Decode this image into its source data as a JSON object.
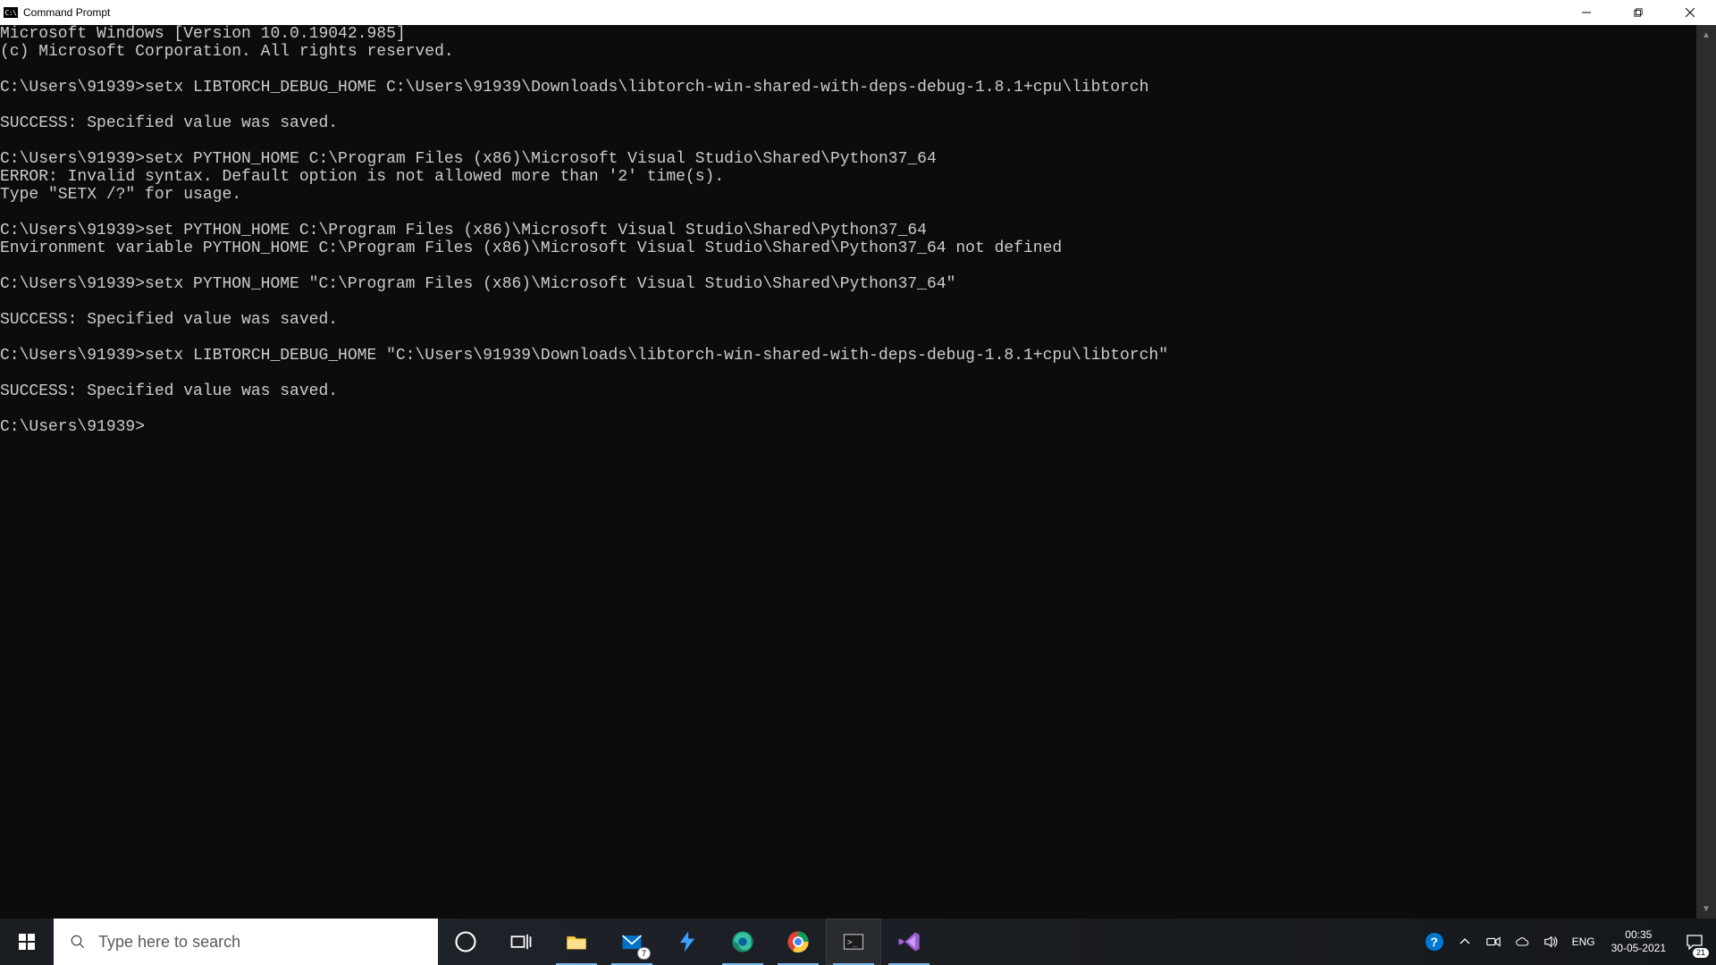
{
  "titlebar": {
    "icon_text": "C:\\",
    "title": "Command Prompt"
  },
  "terminal": {
    "lines": [
      "Microsoft Windows [Version 10.0.19042.985]",
      "(c) Microsoft Corporation. All rights reserved.",
      "",
      "C:\\Users\\91939>setx LIBTORCH_DEBUG_HOME C:\\Users\\91939\\Downloads\\libtorch-win-shared-with-deps-debug-1.8.1+cpu\\libtorch",
      "",
      "SUCCESS: Specified value was saved.",
      "",
      "C:\\Users\\91939>setx PYTHON_HOME C:\\Program Files (x86)\\Microsoft Visual Studio\\Shared\\Python37_64",
      "ERROR: Invalid syntax. Default option is not allowed more than '2' time(s).",
      "Type \"SETX /?\" for usage.",
      "",
      "C:\\Users\\91939>set PYTHON_HOME C:\\Program Files (x86)\\Microsoft Visual Studio\\Shared\\Python37_64",
      "Environment variable PYTHON_HOME C:\\Program Files (x86)\\Microsoft Visual Studio\\Shared\\Python37_64 not defined",
      "",
      "C:\\Users\\91939>setx PYTHON_HOME \"C:\\Program Files (x86)\\Microsoft Visual Studio\\Shared\\Python37_64\"",
      "",
      "SUCCESS: Specified value was saved.",
      "",
      "C:\\Users\\91939>setx LIBTORCH_DEBUG_HOME \"C:\\Users\\91939\\Downloads\\libtorch-win-shared-with-deps-debug-1.8.1+cpu\\libtorch\"",
      "",
      "SUCCESS: Specified value was saved.",
      "",
      "C:\\Users\\91939>"
    ]
  },
  "taskbar": {
    "search_placeholder": "Type here to search",
    "mail_badge": "7",
    "lang": "ENG",
    "time": "00:35",
    "date": "30-05-2021",
    "notif_count": "21"
  }
}
